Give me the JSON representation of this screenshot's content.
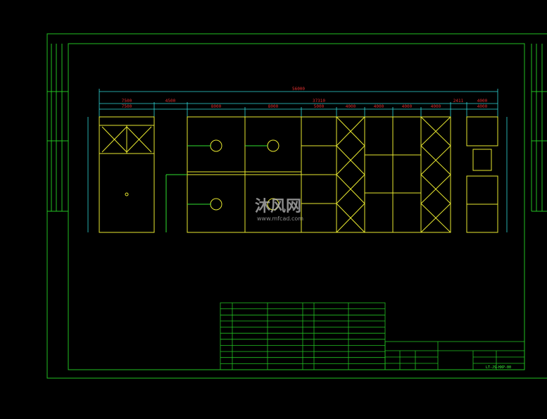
{
  "colors": {
    "frame": "#22c022",
    "equipment": "#e8e830",
    "dimension_line": "#30d8d8",
    "dimension_text": "#e03030",
    "table_text": "#40ff40"
  },
  "dimensions": {
    "overall": "56000",
    "row2": [
      "7500",
      "4500",
      "37310",
      "2411",
      "4000"
    ],
    "row3": [
      "7500",
      "8000",
      "8000",
      "5000",
      "4000",
      "4000",
      "4000",
      "4000",
      "4000"
    ]
  },
  "table": {
    "codes": [
      "LT-JS-HXP-00"
    ]
  },
  "watermark": {
    "brand": "沐风网",
    "url": "www.mfcad.com"
  }
}
